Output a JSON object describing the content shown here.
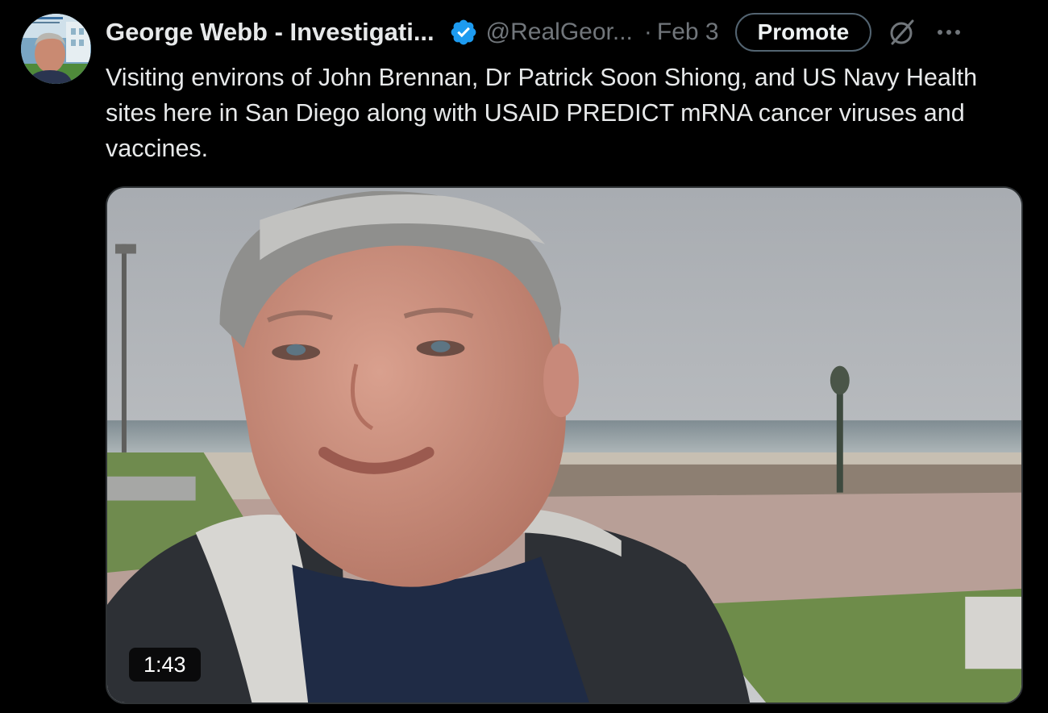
{
  "author": {
    "name": "George Webb - Investigati...",
    "handle": "@RealGeor...",
    "verified": true,
    "date": "Feb 3"
  },
  "separator": "·",
  "actions": {
    "promote_label": "Promote",
    "grok_icon": "grok-icon",
    "more_icon": "more-options-icon"
  },
  "tweet": {
    "text": "Visiting environs of John Brennan, Dr Patrick Soon Shiong, and US Navy Health sites here in San Diego along with USAID PREDICT mRNA cancer viruses and vaccines."
  },
  "media": {
    "type": "video",
    "duration": "1:43"
  },
  "colors": {
    "background": "#000000",
    "text_primary": "#e7e9ea",
    "text_secondary": "#71767b",
    "verified_blue": "#1d9bf0",
    "border": "#2f3336"
  }
}
